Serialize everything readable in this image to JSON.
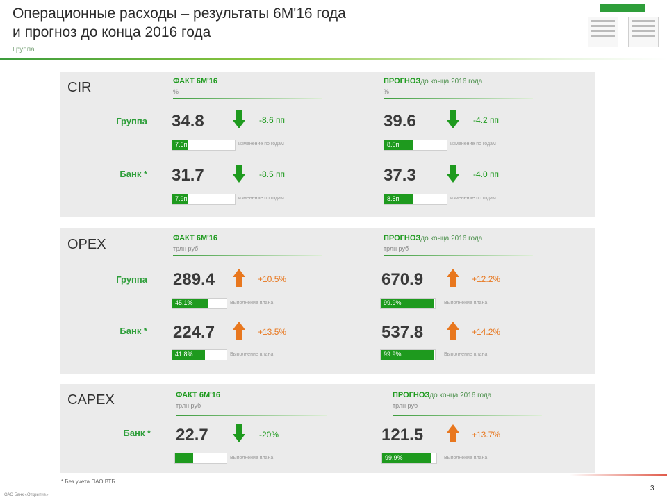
{
  "header": {
    "title_line1": "Операционные расходы – результаты 6М'16 года",
    "title_line2": "и прогноз до конца 2016 года",
    "subtitle": "Группа"
  },
  "colors": {
    "green": "#1e9a1e",
    "orange": "#e8771e",
    "panel": "#ebebeb"
  },
  "panels": {
    "cir": {
      "title": "CIR",
      "fact_head": "ФАКТ 6М'16",
      "fact_sub": "%",
      "forecast_head": "ПРОГНОЗ",
      "forecast_suffix": "до конца 2016 года",
      "forecast_sub": "%",
      "rows": {
        "group": {
          "label": "Группа",
          "fact": {
            "value": "34.8",
            "delta": "-8.6 пп",
            "dir": "down",
            "bar_label": "7.6п",
            "bar_note": "изменение по годам"
          },
          "forecast": {
            "value": "39.6",
            "delta": "-4.2 пп",
            "dir": "down",
            "bar_label": "8.0п",
            "bar_note": "изменение по годам"
          }
        },
        "bank": {
          "label": "Банк *",
          "fact": {
            "value": "31.7",
            "delta": "-8.5 пп",
            "dir": "down",
            "bar_label": "7.9п",
            "bar_note": "изменение по годам"
          },
          "forecast": {
            "value": "37.3",
            "delta": "-4.0 пп",
            "dir": "down",
            "bar_label": "8.5п",
            "bar_note": "изменение по годам"
          }
        }
      }
    },
    "opex": {
      "title": "OPEX",
      "fact_head": "ФАКТ 6М'16",
      "fact_sub": "трлн руб",
      "forecast_head": "ПРОГНОЗ",
      "forecast_suffix": "до конца 2016 года",
      "forecast_sub": "трлн руб",
      "rows": {
        "group": {
          "label": "Группа",
          "fact": {
            "value": "289.4",
            "delta": "+10.5%",
            "dir": "up",
            "bar_label": "45.1%",
            "bar_note": "Выполнение плана"
          },
          "forecast": {
            "value": "670.9",
            "delta": "+12.2%",
            "dir": "up",
            "bar_label": "99.9%",
            "bar_note": "Выполнение плана"
          }
        },
        "bank": {
          "label": "Банк *",
          "fact": {
            "value": "224.7",
            "delta": "+13.5%",
            "dir": "up",
            "bar_label": "41.8%",
            "bar_note": "Выполнение плана"
          },
          "forecast": {
            "value": "537.8",
            "delta": "+14.2%",
            "dir": "up",
            "bar_label": "99.9%",
            "bar_note": "Выполнение плана"
          }
        }
      }
    },
    "capex": {
      "title": "CAPEX",
      "fact_head": "ФАКТ 6М'16",
      "fact_sub": "трлн руб",
      "forecast_head": "ПРОГНОЗ",
      "forecast_suffix": "до конца 2016 года",
      "forecast_sub": "трлн руб",
      "rows": {
        "bank": {
          "label": "Банк *",
          "fact": {
            "value": "22.7",
            "delta": "-20%",
            "dir": "down",
            "bar_label": "",
            "bar_note": "Выполнение плана"
          },
          "forecast": {
            "value": "121.5",
            "delta": "+13.7%",
            "dir": "up",
            "bar_label": "99.9%",
            "bar_note": "Выполнение плана"
          }
        }
      }
    }
  },
  "bar_fill": {
    "cir_gf": 0.26,
    "cir_gfc": 0.45,
    "cir_bf": 0.26,
    "cir_bfc": 0.45,
    "opex_gf": 0.65,
    "opex_gfc": 0.97,
    "opex_bf": 0.6,
    "opex_bfc": 0.97,
    "capex_bf": 0.35,
    "capex_bfc": 0.9
  },
  "footnote": "* Без учета ПАО ВТБ",
  "copyright": "ОАО Банк «Открытие»",
  "page_number": "3"
}
